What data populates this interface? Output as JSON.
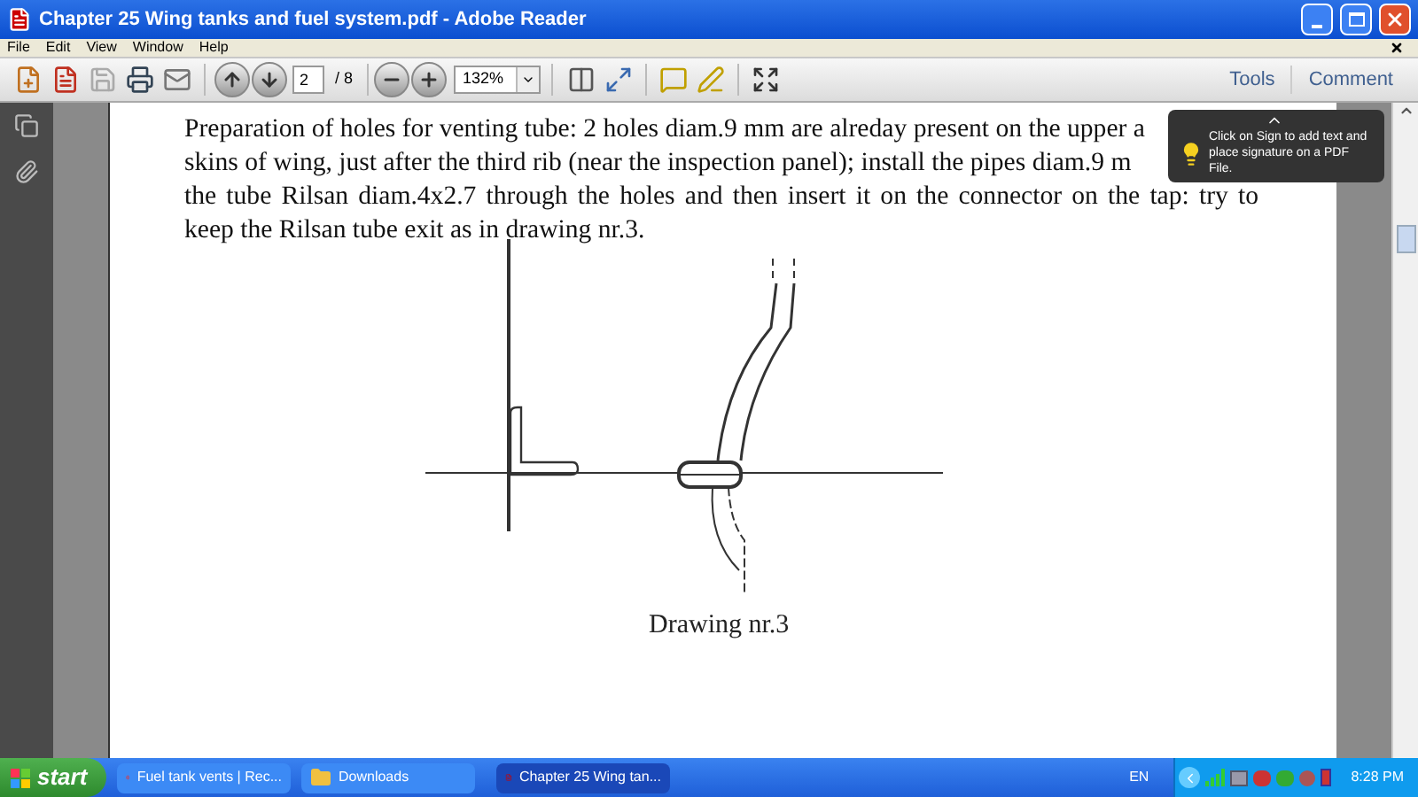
{
  "window": {
    "title": "Chapter 25 Wing tanks and fuel system.pdf - Adobe Reader"
  },
  "menu": [
    "File",
    "Edit",
    "View",
    "Window",
    "Help"
  ],
  "toolbar": {
    "page_number": "2",
    "page_count": "/ 8",
    "zoom": "132%",
    "tools": "Tools",
    "comment": "Comment"
  },
  "tooltip": {
    "text": "Click on Sign to add text and place signature on a PDF File."
  },
  "document": {
    "lines": [
      "Preparation of holes for venting tube: 2 holes diam.9 mm are alreday present on the upper a",
      "skins of wing, just after the third rib (near the inspection panel); install the pipes diam.9 m",
      "the tube Rilsan diam.4x2.7 through the holes and then insert it on the connector on the tap: try to",
      "keep the Rilsan tube exit as in drawing nr.3."
    ],
    "caption": "Drawing nr.3"
  },
  "taskbar": {
    "start": "start",
    "tasks": [
      {
        "label": "Fuel tank vents | Rec...",
        "kind": "browser",
        "selected": false
      },
      {
        "label": "Downloads",
        "kind": "folder",
        "selected": false
      },
      {
        "label": "Chapter 25 Wing tan...",
        "kind": "pdf",
        "selected": true
      }
    ],
    "language": "EN",
    "clock": "8:28 PM"
  }
}
